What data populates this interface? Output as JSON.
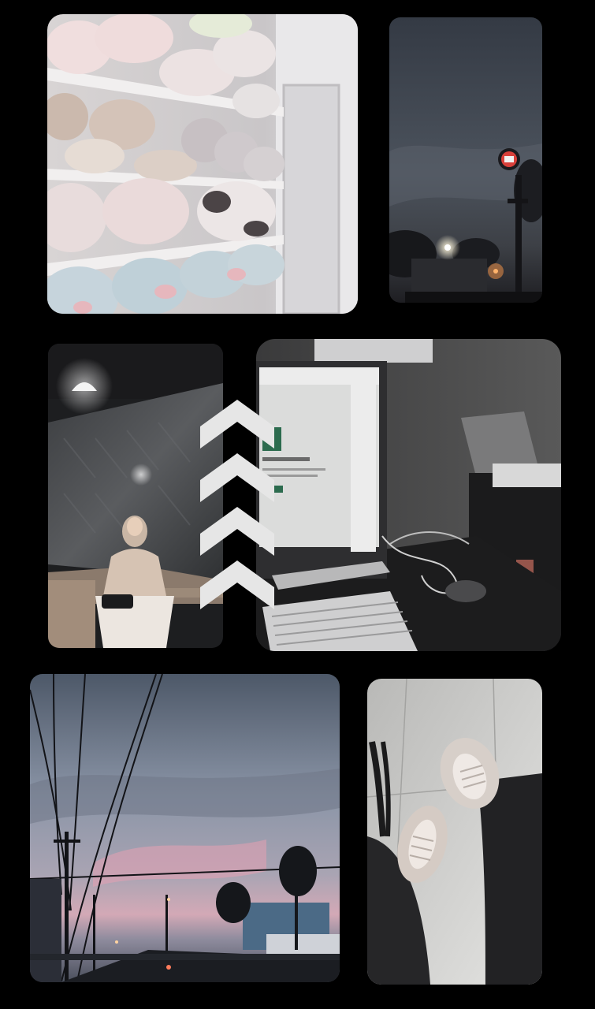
{
  "story": {
    "photos": [
      {
        "id": "plush-toys-shelf"
      },
      {
        "id": "evening-sky-sign"
      },
      {
        "id": "woman-on-bench"
      },
      {
        "id": "computer-monitor"
      },
      {
        "id": "street-sunset"
      },
      {
        "id": "sneakers-floor"
      }
    ],
    "overlay": {
      "chevron_count": 4,
      "direction": "up",
      "color": "#e6e6e6"
    },
    "colors": {
      "background": "#000000"
    }
  }
}
